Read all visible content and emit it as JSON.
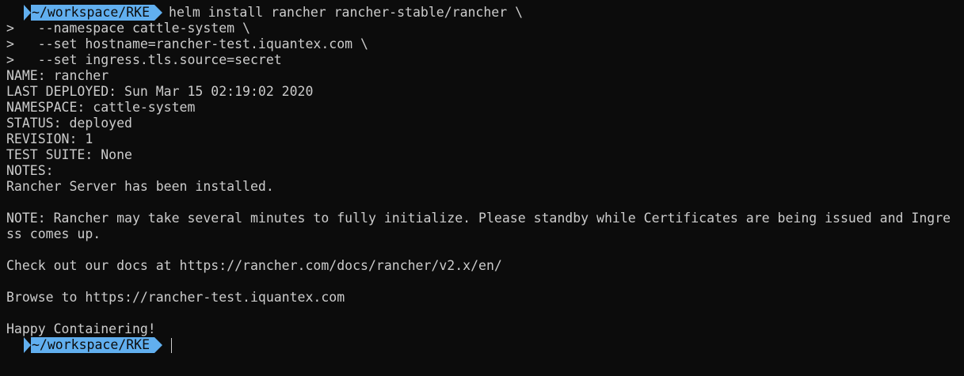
{
  "terminal": {
    "prompt_path": "~/workspace/RKE",
    "command": "helm install rancher rancher-stable/rancher \\",
    "continuation_lines": [
      ">   --namespace cattle-system \\",
      ">   --set hostname=rancher-test.iquantex.com \\",
      ">   --set ingress.tls.source=secret"
    ],
    "output_lines": [
      "NAME: rancher",
      "LAST DEPLOYED: Sun Mar 15 02:19:02 2020",
      "NAMESPACE: cattle-system",
      "STATUS: deployed",
      "REVISION: 1",
      "TEST SUITE: None",
      "NOTES:",
      "Rancher Server has been installed.",
      "",
      "NOTE: Rancher may take several minutes to fully initialize. Please standby while Certificates are being issued and Ingre",
      "ss comes up.",
      "",
      "Check out our docs at https://rancher.com/docs/rancher/v2.x/en/",
      "",
      "Browse to https://rancher-test.iquantex.com",
      "",
      "Happy Containering!"
    ],
    "final_prompt_path": "~/workspace/RKE",
    "colors": {
      "background": "#0c0c0c",
      "foreground": "#cccccc",
      "prompt_segment": "#61afef"
    }
  }
}
